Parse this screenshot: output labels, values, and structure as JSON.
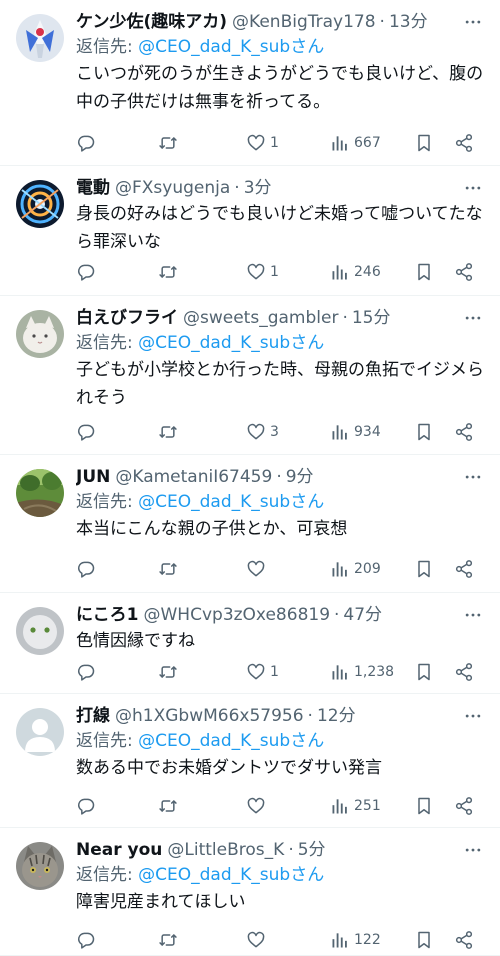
{
  "labels": {
    "reply_prefix": "返信先: ",
    "reply_suffix": "さん",
    "dot": "·"
  },
  "colors": {
    "accent": "#1d9bf0",
    "secondary_text": "#536471",
    "primary_text": "#0f1419",
    "divider": "#eff3f4"
  },
  "tweets": [
    {
      "display_name": "ケン少佐(趣味アカ)",
      "handle": "@KenBigTray178",
      "time": "13分",
      "reply_to": "@CEO_dad_K_sub",
      "text": "こいつが死のうが生きようがどうでも良いけど、腹の中の子供だけは無事を祈ってる。",
      "likes": "1",
      "views": "667",
      "avatar": "robot-avatar"
    },
    {
      "display_name": "電動",
      "handle": "@FXsyugenja",
      "time": "3分",
      "reply_to": "",
      "text": "身長の好みはどうでも良いけど未婚って嘘ついてたなら罪深いな",
      "likes": "1",
      "views": "246",
      "avatar": "swirl-avatar"
    },
    {
      "display_name": "白えびフライ",
      "handle": "@sweets_gambler",
      "time": "15分",
      "reply_to": "@CEO_dad_K_sub",
      "text": "子どもが小学校とか行った時、母親の魚拓でイジメられそう",
      "likes": "3",
      "views": "934",
      "avatar": "cat-avatar"
    },
    {
      "display_name": "JUN",
      "handle": "@KametaniI67459",
      "time": "9分",
      "reply_to": "@CEO_dad_K_sub",
      "text": "本当にこんな親の子供とか、可哀想",
      "likes": "",
      "views": "209",
      "avatar": "garden-avatar"
    },
    {
      "display_name": "にころ1",
      "handle": "@WHCvp3zOxe86819",
      "time": "47分",
      "reply_to": "",
      "text": "色情因縁ですね",
      "likes": "1",
      "views": "1,238",
      "avatar": "plush-avatar"
    },
    {
      "display_name": "打線",
      "handle": "@h1XGbwM66x57956",
      "time": "12分",
      "reply_to": "@CEO_dad_K_sub",
      "text": "数ある中でお未婚ダントツでダサい発言",
      "likes": "",
      "views": "251",
      "avatar": "default-avatar"
    },
    {
      "display_name": "Near you",
      "handle": "@LittleBros_K",
      "time": "5分",
      "reply_to": "@CEO_dad_K_sub",
      "text": "障害児産まれてほしい",
      "likes": "",
      "views": "122",
      "avatar": "tabby-avatar"
    }
  ]
}
